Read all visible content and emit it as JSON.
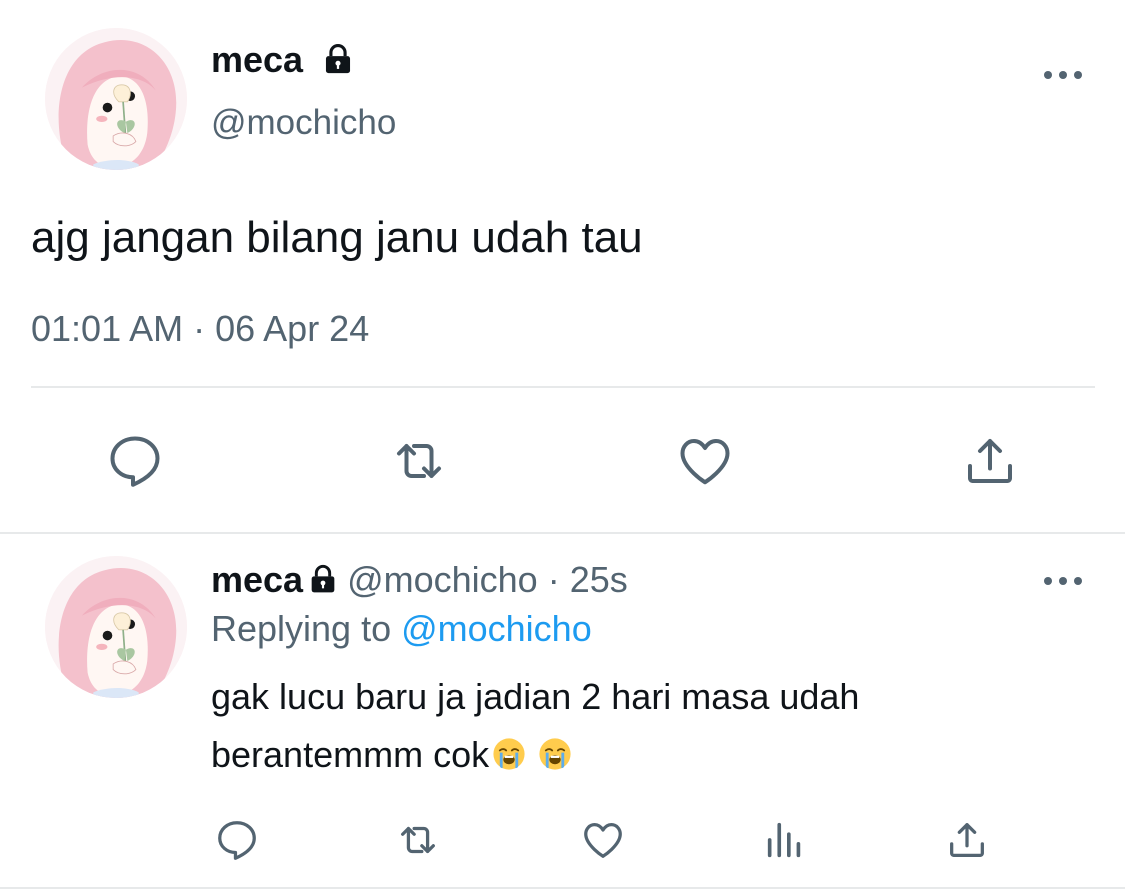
{
  "main_tweet": {
    "name": "meca",
    "handle": "@mochicho",
    "text": "ajg jangan bilang janu udah tau",
    "timestamp": "01:01 AM · 06 Apr 24",
    "icons": [
      "avatar",
      "lock-icon",
      "more-icon",
      "reply-icon",
      "retweet-icon",
      "like-icon",
      "share-icon"
    ]
  },
  "reply_tweet": {
    "name": "meca",
    "handle": "@mochicho",
    "separator": " · ",
    "age": "25s",
    "replying_prefix": "Replying to ",
    "replying_mention": "@mochicho",
    "text": "gak lucu baru ja jadian 2 hari masa udah berantemmm cok",
    "emojis": [
      "loudly-crying-face",
      "loudly-crying-face"
    ],
    "icons": [
      "avatar",
      "lock-icon",
      "more-icon",
      "reply-icon",
      "retweet-icon",
      "like-icon",
      "analytics-icon",
      "share-icon"
    ]
  },
  "colors": {
    "text_primary": "#0f1419",
    "text_secondary": "#536471",
    "mention": "#1d9bf0",
    "icon": "#536471",
    "divider": "#e7e9ea"
  }
}
